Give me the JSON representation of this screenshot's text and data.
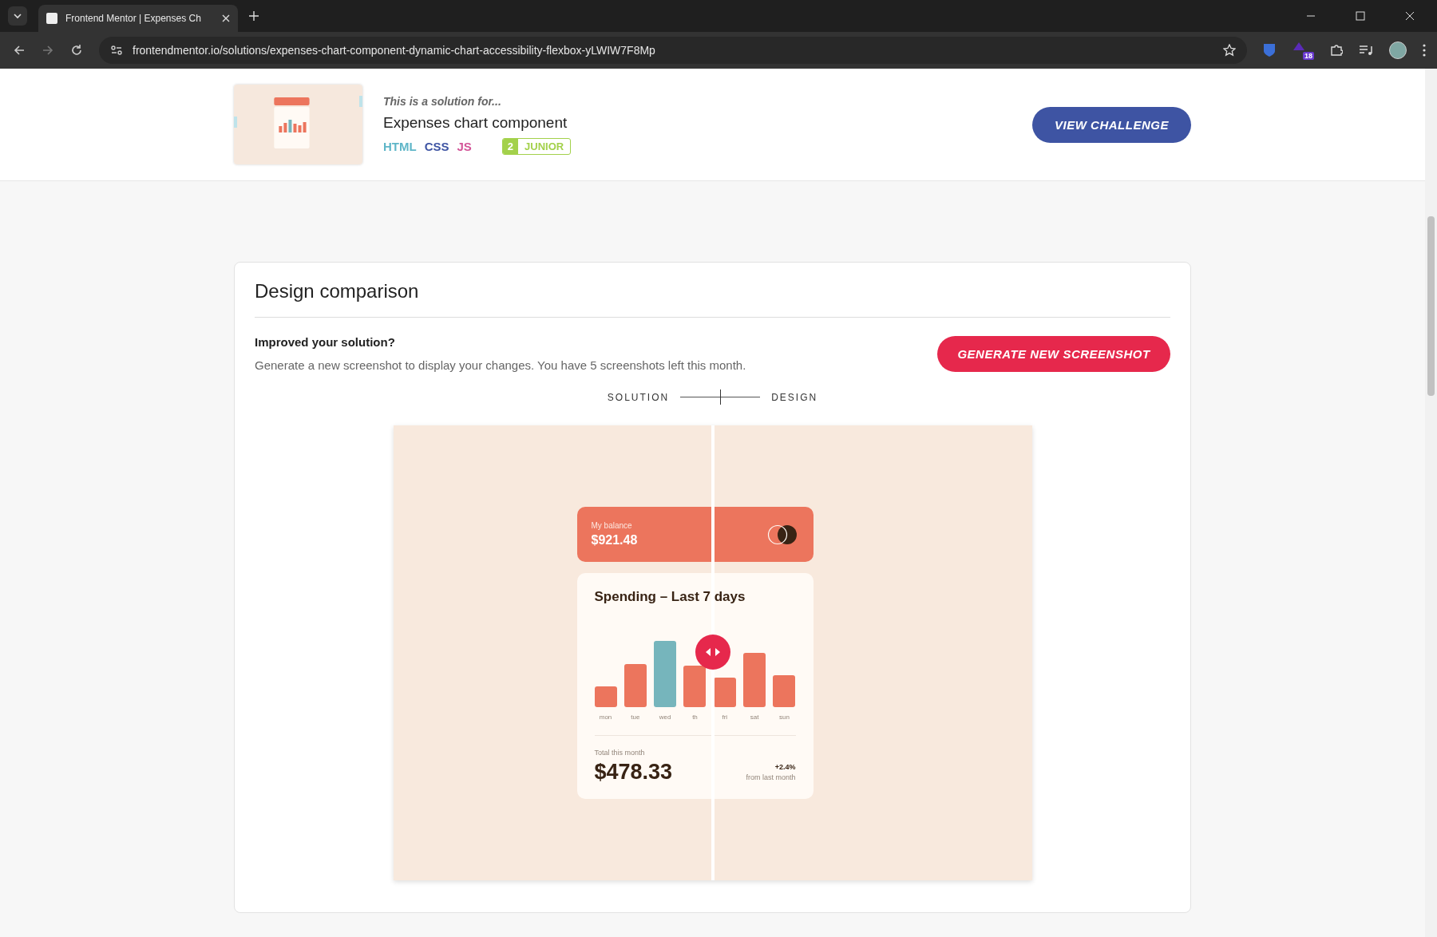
{
  "browser": {
    "tab_title": "Frontend Mentor | Expenses Ch",
    "url": "frontendmentor.io/solutions/expenses-chart-component-dynamic-chart-accessibility-flexbox-yLWIW7F8Mp",
    "extension_badge": "18"
  },
  "challenge": {
    "kicker": "This is a solution for...",
    "title": "Expenses chart component",
    "languages": [
      {
        "label": "HTML",
        "color": "#5fb6c8"
      },
      {
        "label": "CSS",
        "color": "#3e54a3"
      },
      {
        "label": "JS",
        "color": "#d35598"
      }
    ],
    "level": {
      "number": "2",
      "label": "JUNIOR"
    },
    "button": "VIEW CHALLENGE"
  },
  "comparison": {
    "title": "Design comparison",
    "prompt": "Improved your solution?",
    "note": "Generate a new screenshot to display your changes. You have 5 screenshots left this month.",
    "button": "GENERATE NEW SCREENSHOT",
    "toggle": {
      "left": "SOLUTION",
      "right": "DESIGN",
      "level": 0.5
    },
    "preview": {
      "level": 0.5,
      "balance_label": "My balance",
      "balance": "$921.48",
      "chart_title": "Spending – Last 7 days",
      "days": [
        {
          "label": "mon",
          "highlighted": false
        },
        {
          "label": "tue",
          "highlighted": false
        },
        {
          "label": "wed",
          "highlighted": true
        },
        {
          "label": "th",
          "highlighted": false
        },
        {
          "label": "fri",
          "highlighted": false
        },
        {
          "label": "sat",
          "highlighted": false
        },
        {
          "label": "sun",
          "highlighted": false
        }
      ],
      "total_label": "Total this month",
      "total": "$478.33",
      "change": "+2.4%",
      "change_label": "from last month"
    }
  }
}
